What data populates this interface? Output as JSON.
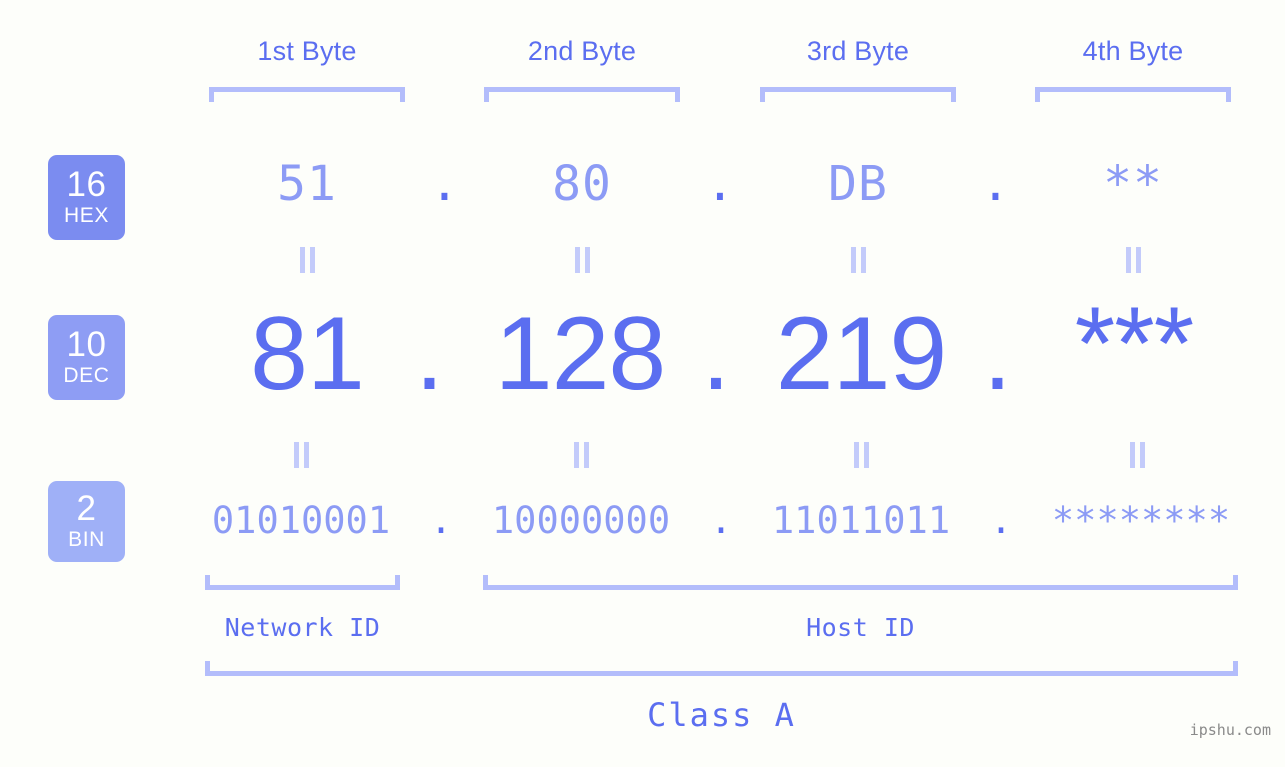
{
  "background_color": "#fdfefa",
  "colors": {
    "accent_strong": "#5b6ef0",
    "accent_mid": "#8c9bf5",
    "accent_light": "#b3bdfb",
    "badge_hex_bg": "#7b8cf0",
    "badge_dec_bg": "#8e9df4",
    "badge_bin_bg": "#9fb0f7",
    "watermark": "#8a8a8a"
  },
  "byte_headers": [
    {
      "label": "1st Byte"
    },
    {
      "label": "2nd Byte"
    },
    {
      "label": "3rd Byte"
    },
    {
      "label": "4th Byte"
    }
  ],
  "radix_badges": [
    {
      "number": "16",
      "abbr": "HEX"
    },
    {
      "number": "10",
      "abbr": "DEC"
    },
    {
      "number": "2",
      "abbr": "BIN"
    }
  ],
  "separator": ".",
  "equals_symbol": "=",
  "rows": {
    "hex": {
      "radix": "16",
      "name": "HEX",
      "values": [
        "51",
        "80",
        "DB",
        "**"
      ]
    },
    "dec": {
      "radix": "10",
      "name": "DEC",
      "values": [
        "81",
        "128",
        "219",
        "***"
      ]
    },
    "bin": {
      "radix": "2",
      "name": "BIN",
      "values": [
        "01010001",
        "10000000",
        "11011011",
        "********"
      ]
    }
  },
  "id_sections": [
    {
      "label": "Network ID"
    },
    {
      "label": "Host ID"
    }
  ],
  "class_label": "Class A",
  "watermark": "ipshu.com"
}
